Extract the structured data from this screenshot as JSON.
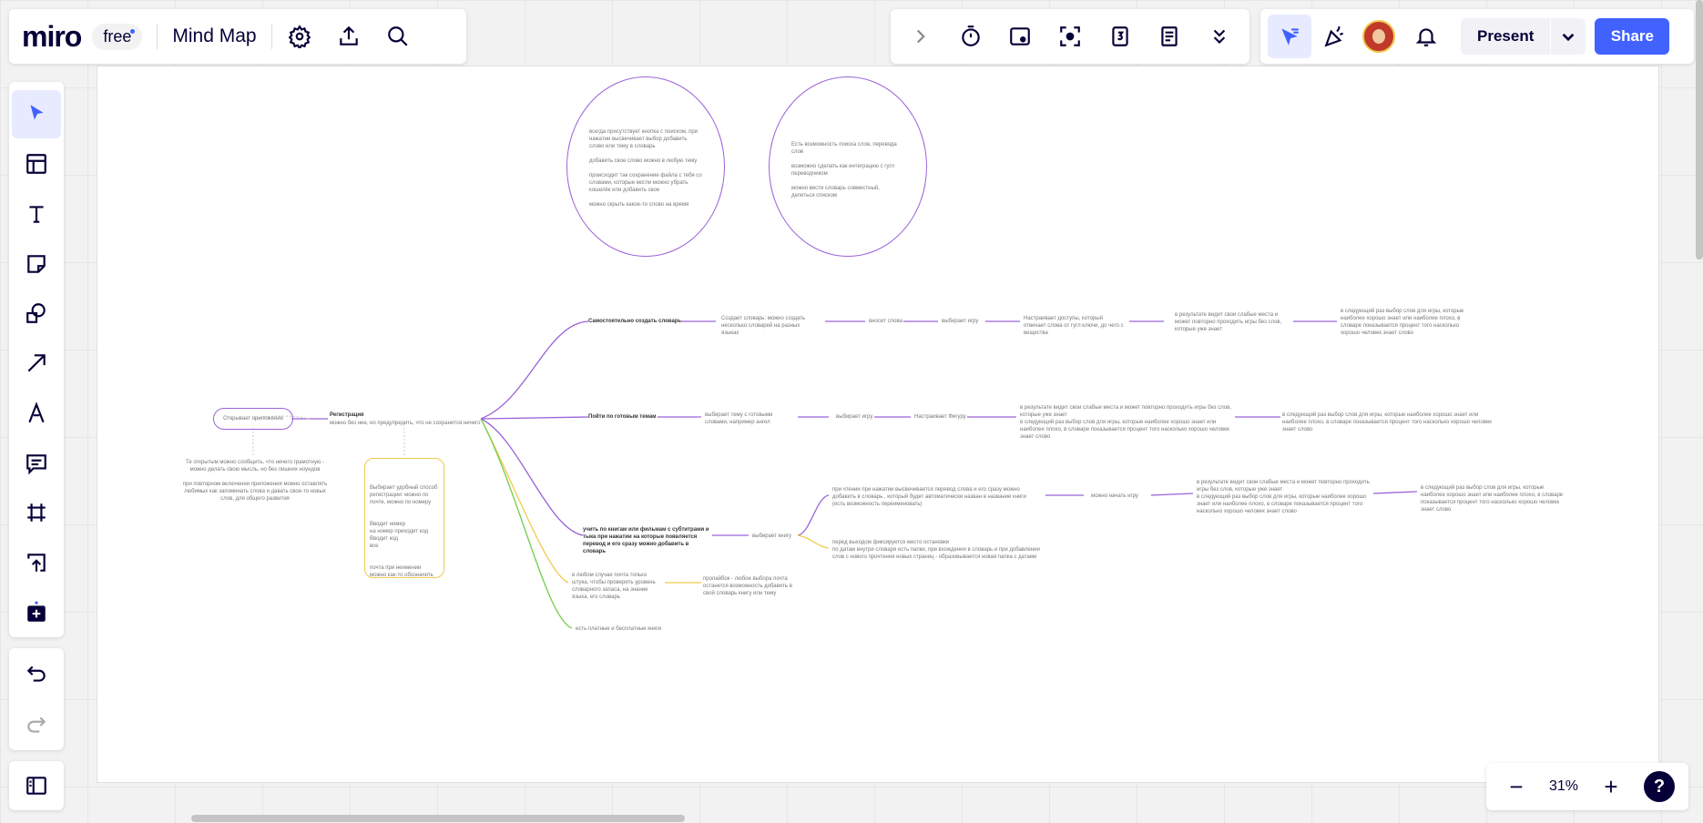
{
  "topbar": {
    "logo": "miro",
    "plan_badge": "free",
    "board_title": "Mind Map"
  },
  "right_toolbar": {
    "present_label": "Present",
    "share_label": "Share"
  },
  "zoom": {
    "minus": "−",
    "level": "31%",
    "plus": "+",
    "help": "?"
  },
  "canvas": {
    "ellipse1": [
      "всегда присутствует кнопка с поиском, при нажатии высвечивает выбор добавить слово или тему в словарь",
      "добавить свое слово можно в любую тему",
      "происходит так сохранение файла с тебя со словами, которые могли можно убрать кошелёк или добавить свое",
      "можно скрыть какое-то слово на время"
    ],
    "ellipse2": [
      "Есть возможность поиска слов, перевода слов",
      "возможно сделать как интеграцию с гугл переводчиком",
      "можно вести словарь совместный, делиться списком"
    ],
    "root": "Открывает приложение",
    "root_notes": [
      "Те открытым можно сообщить, что нечего грамотную - можно делать свою мысль, но без лишних ноундов",
      "при повторном включении приложения можно оставлять любимых как запоминать слова и давать свое-то новых слов, для общего развития"
    ],
    "registration_title": "Регистрация",
    "registration_sub": "можно без нее, но предупредить, что не сохранится ничего",
    "registration_box": [
      "Выбирает удобный способ регистрации: можно по почте, можно по номеру",
      "Вводит номер\nна номер приходит код\nВводит код\nвсе",
      "почта при неимении можно как-то обозначить"
    ],
    "branch1": "Самостоятельно создать словарь",
    "branch1_nodes": [
      "Создает словарь: можно создать несколько словарей на разных языках",
      "вносит слова",
      "выбирает игру",
      "Настраивает доступы, который отвечает слова от гугл ключи, до чего с вещества",
      "в результате видит свои слабые места и может повторно проходить игры без слов, которые уже знает",
      "в следующий раз выбор слов для игры, которые наиболее хорошо знает или наиболее плохо, в словаре показывается процент того насколько хорошо человек знает слово"
    ],
    "branch2": "Пойти по готовым темам",
    "branch2_nodes": [
      "выбирает тему с готовыми словами, например ангел",
      "выбирает игру",
      "Настраивает Фигуру",
      "в результате видит свои слабые места и может повторно проходить игры без слов, которые уже знает\nв следующий раз выбор слов для игры, которые наиболее хорошо знает или наиболее плохо, в словаре показывается процент того насколько хорошо человек знает слово",
      "в следующий раз выбор слов для игры, которые наиболее хорошо знает или наиболее плохо, в словаре показывается процент того насколько хорошо человек знает слово"
    ],
    "branch3": "учить по книгам или фильмам с субтитрами и тыка при нажатии на которые появляется перевод и его сразу можно добавить в словарь",
    "branch3_nodes": [
      "выбирает книгу",
      "при чтении при нажатии высвечивается перевод слова и его сразу можно добавить в словарь , который будет автоматически назван в название книги (есть возможность переименовать)",
      "можно начать игру",
      "в результате видит свои слабые места и может повторно проходить игры без слов, которые уже знает\nв следующий раз выбор слов для игры, которые наиболее хорошо знает или наиболее плохо, в словаре показывается процент того насколько хорошо человек знает слово",
      "в следующий раз выбор слов для игры, которые наиболее хорошо знает или наиболее плохо, в словаре показывается процент того насколько хорошо человек знает слово",
      "перед выходом фиксируется место остановки\nпо датам внутри словаря есть папки, при вхождении в словарь и при добавлении слов с нового прочтения новых страниц - образовывается новая папка с датами"
    ],
    "branch4": "в любом случае почта только штука, чтобы проверить уровень словарного запаса, на знание языка, его словарь",
    "branch4_node": "пролайбок - любое выбора почта останется возможность добавить в свой словарь книгу или тему",
    "branch5": "есть платные и бесплатные книги"
  }
}
